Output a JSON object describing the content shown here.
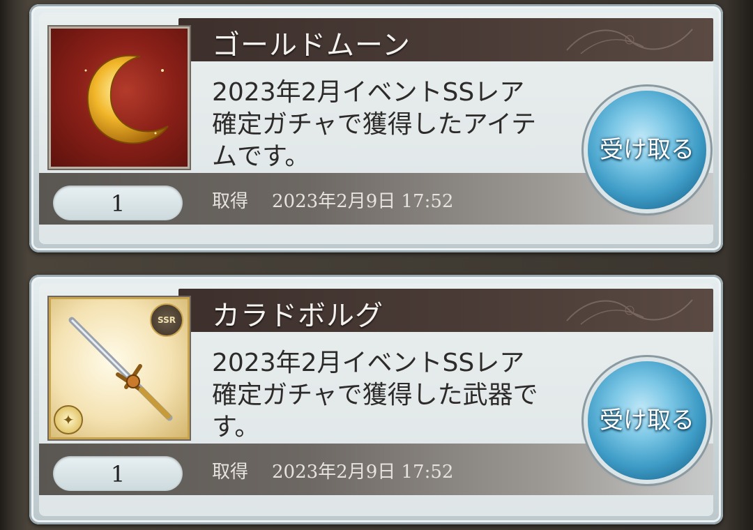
{
  "items": [
    {
      "name": "ゴールドムーン",
      "description_lines": [
        "2023年2月イベントSSレア",
        "確定ガチャで獲得したアイテ",
        "ムです。"
      ],
      "quantity": "1",
      "acquired_label": "取得",
      "acquired_date": "2023年2月9日 17:52",
      "button_label": "受け取る",
      "icon": "gold-moon-icon"
    },
    {
      "name": "カラドボルグ",
      "description_lines": [
        "2023年2月イベントSSレア",
        "確定ガチャで獲得した武器で",
        "す。"
      ],
      "quantity": "1",
      "acquired_label": "取得",
      "acquired_date": "2023年2月9日 17:52",
      "button_label": "受け取る",
      "icon": "sword-icon",
      "rarity_badge": "SSR",
      "element_icon": "light-element-icon"
    }
  ],
  "colors": {
    "title_bar": "#3d302c",
    "button_blue": "#3e9cc6",
    "card_bg": "#dfe6e7"
  }
}
